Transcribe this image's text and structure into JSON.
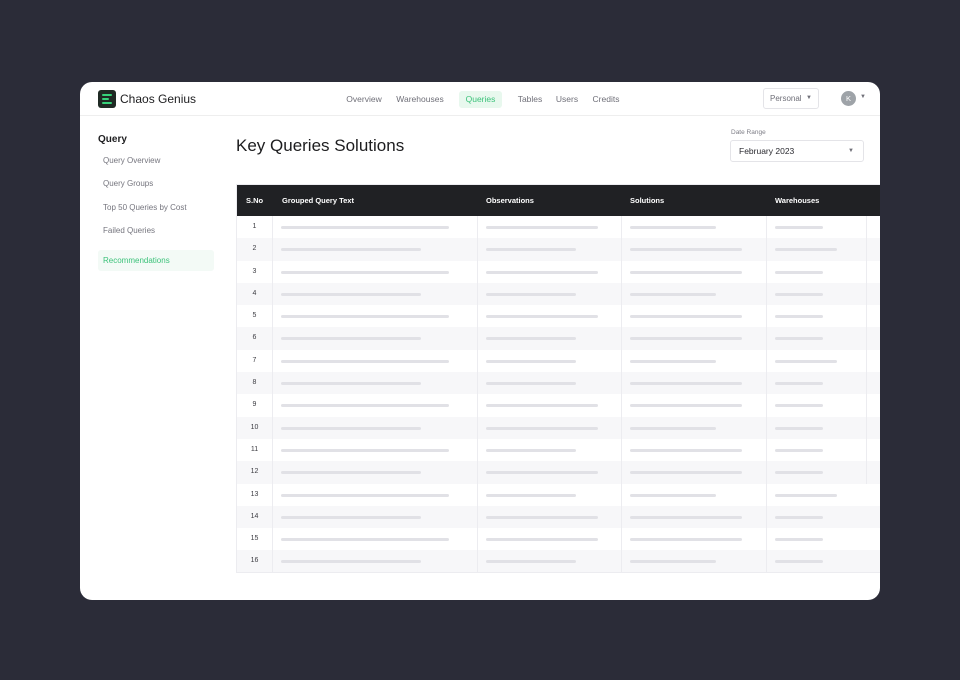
{
  "brand": {
    "name": "Chaos Genius",
    "accent": "#3cc27a"
  },
  "nav": {
    "items": [
      {
        "label": "Overview",
        "active": false
      },
      {
        "label": "Warehouses",
        "active": false
      },
      {
        "label": "Queries",
        "active": true
      },
      {
        "label": "Tables",
        "active": false
      },
      {
        "label": "Users",
        "active": false
      },
      {
        "label": "Credits",
        "active": false
      }
    ]
  },
  "account": {
    "org": "Personal",
    "avatar_initial": "K"
  },
  "sidebar": {
    "title": "Query",
    "items": [
      {
        "label": "Query Overview",
        "active": false
      },
      {
        "label": "Query Groups",
        "active": false
      },
      {
        "label": "Top 50 Queries by Cost",
        "active": false
      },
      {
        "label": "Failed Queries",
        "active": false
      },
      {
        "label": "Recommendations",
        "active": true
      }
    ]
  },
  "main": {
    "title": "Key Queries Solutions",
    "date_range": {
      "label": "Date Range",
      "value": "February 2023"
    }
  },
  "table": {
    "columns": [
      "S.No",
      "Grouped Query Text",
      "Observations",
      "Solutions",
      "Warehouses"
    ],
    "rows": [
      "1",
      "2",
      "3",
      "4",
      "5",
      "6",
      "7",
      "8",
      "9",
      "10",
      "11",
      "12",
      "13",
      "14",
      "15",
      "16"
    ]
  }
}
